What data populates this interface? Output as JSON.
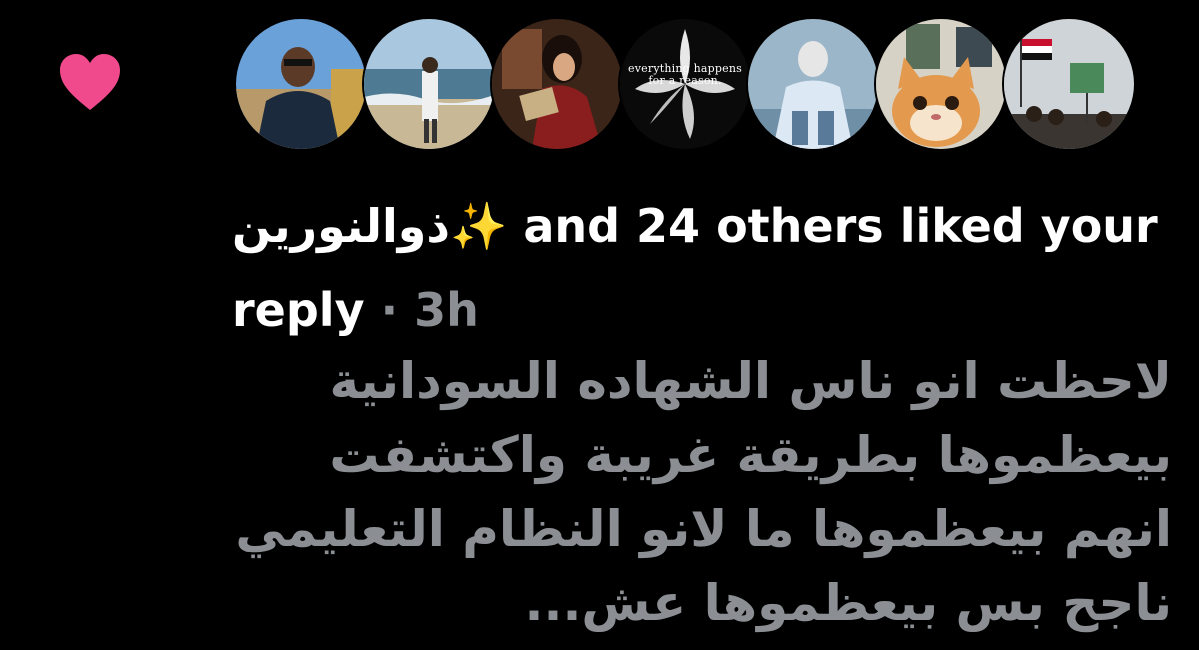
{
  "notification": {
    "type": "like",
    "heart_icon": "heart-icon",
    "heart_color": "#f04a8c",
    "liker_name": "ذوالنورين",
    "liker_emoji": "✨",
    "others_text": "and 24 others liked your reply",
    "separator": "·",
    "time": "3h",
    "avatars": [
      {
        "name": "avatar-1"
      },
      {
        "name": "avatar-2"
      },
      {
        "name": "avatar-3"
      },
      {
        "name": "avatar-4",
        "caption": "everything happens for a reason."
      },
      {
        "name": "avatar-5"
      },
      {
        "name": "avatar-6"
      },
      {
        "name": "avatar-7"
      }
    ],
    "reply_preview": "لاحظت انو ناس الشهاده السودانية بيعظموها بطريقة غريبة واكتشفت انهم بيعظموها ما لانو النظام التعليمي ناجح بس بيعظموها عش..."
  },
  "colors": {
    "background": "#000000",
    "primary_text": "#ffffff",
    "secondary_text": "#8b8f94",
    "sparkle": "#f8d04a"
  }
}
